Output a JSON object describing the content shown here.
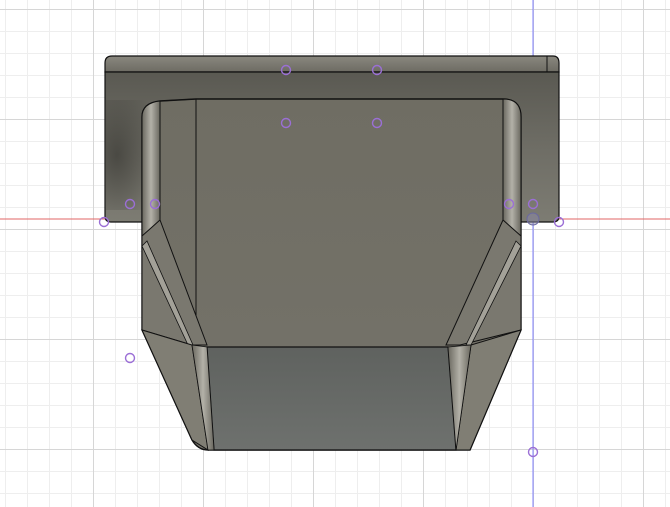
{
  "viewport": {
    "background": "#ffffff",
    "grid_minor_color": "#eeeeee",
    "grid_major_color": "#d6d6d6",
    "axis_x_color": "#e06666",
    "axis_y_color": "#8080ff"
  },
  "model": {
    "flange_color": "#6b6a62",
    "body_color": "#727066",
    "front_face_color": "#686b68",
    "side_face_color": "#807e74",
    "fillet_color": "#9a988f",
    "edge_color": "#111111"
  },
  "sketch_points": {
    "color": "#9b6fd6",
    "count": 12
  }
}
